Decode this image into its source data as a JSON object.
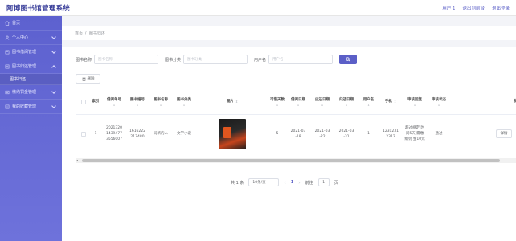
{
  "app": {
    "title": "阿博图书馆管理系统"
  },
  "header": {
    "user_label": "用户 1",
    "back_label": "退出到前台",
    "logout_label": "退出登录"
  },
  "sidebar": {
    "items": [
      {
        "label": "首页",
        "icon": "home-icon"
      },
      {
        "label": "个人中心",
        "icon": "user-icon",
        "expandable": true
      },
      {
        "label": "图书借阅管理",
        "icon": "book-icon",
        "expandable": true
      },
      {
        "label": "图书归还管理",
        "icon": "book-icon",
        "expandable": true,
        "open": true
      },
      {
        "label": "图书归还",
        "sub": true
      },
      {
        "label": "缴纳罚金管理",
        "icon": "money-icon",
        "expandable": true
      },
      {
        "label": "我的收藏管理",
        "icon": "star-icon",
        "expandable": true
      }
    ]
  },
  "breadcrumb": {
    "home": "首页",
    "separator": "/",
    "current": "图书归还"
  },
  "filters": [
    {
      "label": "图书名称",
      "placeholder": "图书名称"
    },
    {
      "label": "图书分类",
      "placeholder": "图书分类"
    },
    {
      "label": "用户名",
      "placeholder": "用户名"
    }
  ],
  "toolbar": {
    "delete_label": "删除"
  },
  "table": {
    "columns": [
      "索引",
      "借阅单号",
      "图书编号",
      "图书名称",
      "图书分类",
      "图片",
      "可借天数",
      "借阅日期",
      "应还日期",
      "归还日期",
      "用户名",
      "手机",
      "审核回复",
      "审核状态",
      "操"
    ],
    "row": {
      "index": "1",
      "order_no": "2021320 1439477 3556007",
      "book_no": "1616222 217480",
      "book_name": "局新的人",
      "category": "文学小说",
      "days": "5",
      "borrow_date": "2021-03 -18",
      "due_date": "2021-03 -22",
      "return_date": "2021-03 -31",
      "username": "1",
      "phone": "1231231 2312",
      "reply": "超过规定 时间5天 需缴纳罚 金10元",
      "status": "通过",
      "detail_label": "详情"
    }
  },
  "pagination": {
    "total": "共 1 条",
    "page_size": "10条/页",
    "current": "1",
    "goto_label": "前往",
    "goto_value": "1",
    "page_suffix": "页"
  },
  "colors": {
    "primary": "#5b5fc7",
    "sidebar": "#5d61cf"
  }
}
